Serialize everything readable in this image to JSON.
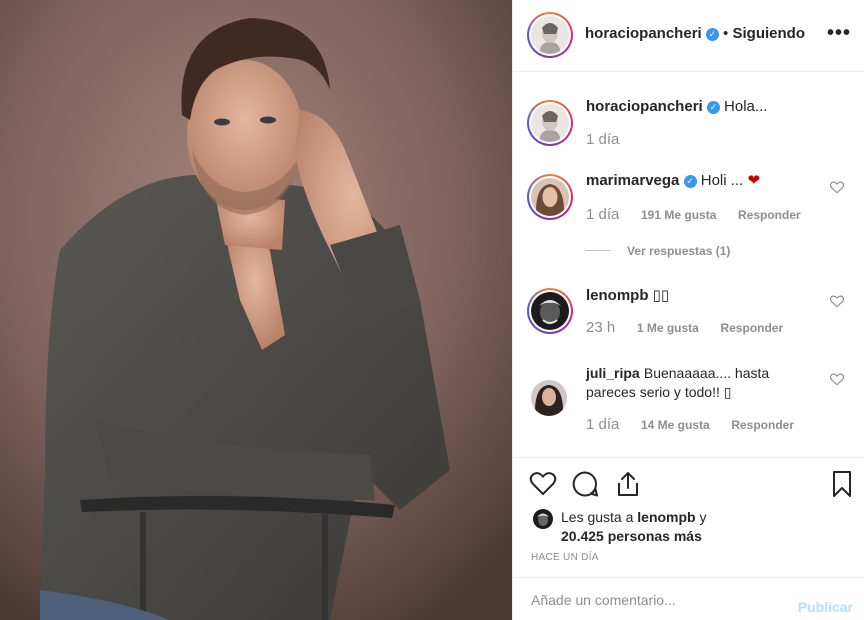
{
  "post_image": {
    "alt_subject": "portrait"
  },
  "header": {
    "username": "horaciopancheri",
    "verified_icon": "verified-badge-icon",
    "separator": "•",
    "follow_status": "Siguiendo",
    "more_icon": "more-options-icon",
    "more_label": "•••"
  },
  "caption": {
    "username": "horaciopancheri",
    "text": "Hola...",
    "time": "1 día"
  },
  "comments": [
    {
      "username": "marimarvega",
      "verified": true,
      "text": "Holi ...",
      "emoji": "❤",
      "time": "1 día",
      "likes": "191 Me gusta",
      "reply": "Responder"
    },
    {
      "username": "lenompb",
      "verified": false,
      "text": "▯▯",
      "time": "23 h",
      "likes": "1 Me gusta",
      "reply": "Responder"
    },
    {
      "username": "juli_ripa",
      "verified": false,
      "text": "Buenaaaaa.... hasta pareces serio y todo!! ▯",
      "time": "1 día",
      "likes": "14 Me gusta",
      "reply": "Responder"
    }
  ],
  "view_replies": "Ver respuestas (1)",
  "actions": {
    "like_icon": "heart-icon",
    "comment_icon": "comment-icon",
    "share_icon": "share-icon",
    "save_icon": "bookmark-icon"
  },
  "likes": {
    "prefix": "Les gusta a",
    "user": "lenompb",
    "conj": "y",
    "count": "20.425 personas más"
  },
  "time_ago": "HACE UN DÍA",
  "comment_input": {
    "placeholder": "Añade un comentario...",
    "value": ""
  },
  "publish_label": "Publicar",
  "colors": {
    "verified": "#3897f0",
    "publish_disabled": "#b2dffc",
    "heart": "#c00"
  }
}
